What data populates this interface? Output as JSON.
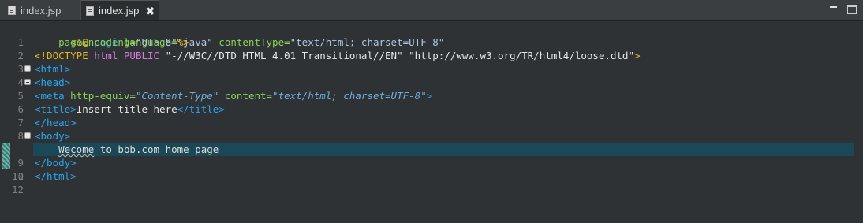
{
  "tabs": [
    {
      "label": "index.jsp",
      "active": false
    },
    {
      "label": "index.jsp",
      "active": true,
      "close": "✖"
    }
  ],
  "editor": {
    "line_numbers": [
      "1",
      "2",
      "3",
      "4",
      "5",
      "6",
      "7",
      "8",
      "9",
      "10",
      "11",
      "12"
    ],
    "lines": {
      "l1": {
        "open": "<%@",
        "kw": " page ",
        "a1": "language=",
        "v1": "\"java\"",
        "a2": " contentType=",
        "v2": "\"text/html; charset=UTF-8\""
      },
      "l2": {
        "indent": "    ",
        "a1": "pageEncoding=",
        "v1": "\"UTF-8\"",
        "close": "%>"
      },
      "l3": {
        "open": "<!DOCTYPE",
        "mid": " html PUBLIC ",
        "s1": "\"-//W3C//DTD HTML 4.01 Transitional//EN\"",
        "s2": " \"http://www.w3.org/TR/html4/loose.dtd\"",
        "close": ">"
      },
      "l4": {
        "tag": "<html>"
      },
      "l5": {
        "tag": "<head>"
      },
      "l6": {
        "open": "<meta",
        "a1": " http-equiv=",
        "v1": "\"Content-Type\"",
        "a2": " content=",
        "v2": "\"text/html; charset=UTF-8\"",
        "close": ">"
      },
      "l7": {
        "open": "<title>",
        "text": "Insert title here",
        "close": "</title>"
      },
      "l8": {
        "tag": "</head>"
      },
      "l9": {
        "tag": "<body>"
      },
      "l10": {
        "indent": "    ",
        "word": "Wecome",
        "rest": " to bbb.com home page"
      },
      "l11": {
        "tag": "</body>"
      },
      "l12": {
        "tag": "</html>"
      }
    },
    "active_line": 10
  },
  "colors": {
    "tag": "#2aa5f0",
    "attribute": "#8bd15b",
    "string": "#b0c6e0",
    "directive": "#e6b422",
    "active_line_bg": "#1a4856",
    "background": "#2f3234"
  }
}
